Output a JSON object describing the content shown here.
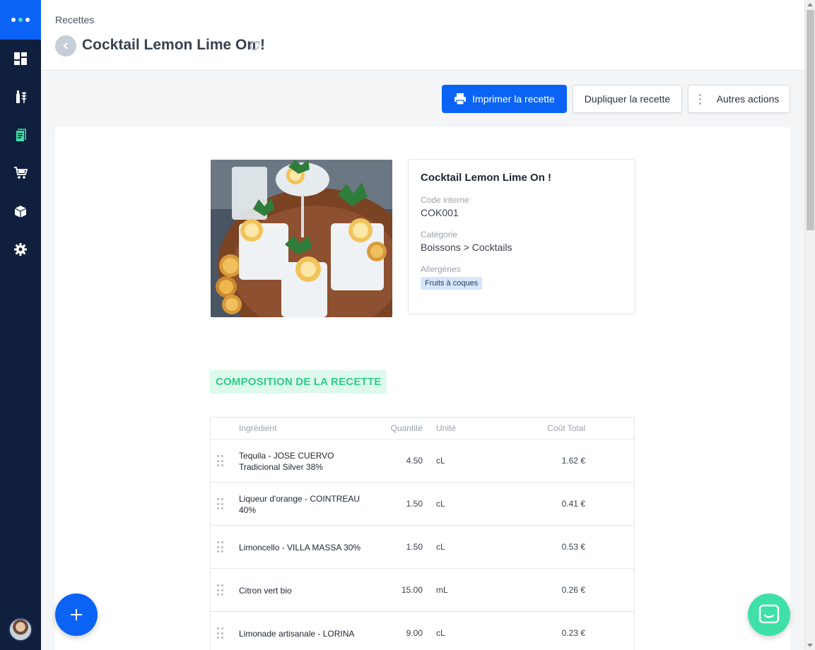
{
  "colors": {
    "sidebar": "#0f1f3d",
    "accent": "#0b63f6",
    "success": "#2ecc87",
    "badge": "#d5e6fb"
  },
  "sidebar": {
    "items": [
      {
        "icon": "dashboard-icon"
      },
      {
        "icon": "bottle-wheat-icon"
      },
      {
        "icon": "recipe-book-icon",
        "active": true
      },
      {
        "icon": "cart-icon"
      },
      {
        "icon": "box-icon"
      },
      {
        "icon": "gear-icon"
      }
    ]
  },
  "header": {
    "breadcrumb": "Recettes",
    "title": "Cocktail Lemon Lime On !"
  },
  "actions": {
    "print": "Imprimer la recette",
    "duplicate": "Dupliquer la recette",
    "more": "Autres actions"
  },
  "recipe": {
    "title": "Cocktail Lemon Lime On !",
    "code_label": "Code interne",
    "code": "COK001",
    "category_label": "Catégorie",
    "category": "Boissons > Cocktails",
    "allergens_label": "Allergènes",
    "allergen": "Fruits à coques"
  },
  "composition": {
    "title": "COMPOSITION DE LA RECETTE",
    "columns": {
      "ingredient": "Ingrédient",
      "quantity": "Quantité",
      "unit": "Unité",
      "cost": "Coût Total"
    },
    "rows": [
      {
        "name": "Tequila - JOSE CUERVO Tradicional Silver 38%",
        "qty": "4.50",
        "unit": "cL",
        "cost": "1.62 €"
      },
      {
        "name": "Liqueur d'orange - COINTREAU 40%",
        "qty": "1.50",
        "unit": "cL",
        "cost": "0.41 €"
      },
      {
        "name": "Limoncello - VILLA MASSA 30%",
        "qty": "1.50",
        "unit": "cL",
        "cost": "0.53 €"
      },
      {
        "name": "Citron vert bio",
        "qty": "15.00",
        "unit": "mL",
        "cost": "0.26 €"
      },
      {
        "name": "Limonade artisanale - LORINA",
        "qty": "9.00",
        "unit": "cL",
        "cost": "0.23 €"
      }
    ]
  }
}
